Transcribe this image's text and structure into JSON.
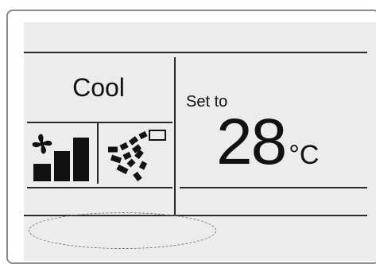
{
  "mode": {
    "label": "Cool"
  },
  "fan": {
    "icon": "fan-icon",
    "speed_level": 3,
    "speed_max": 3
  },
  "swing": {
    "icon": "louver-swing-icon"
  },
  "setpoint": {
    "label": "Set to",
    "value": "28",
    "unit": "°C"
  },
  "colors": {
    "display_background": "#ececec",
    "segment_color": "#111111",
    "divider_color": "#2a2a2a"
  }
}
